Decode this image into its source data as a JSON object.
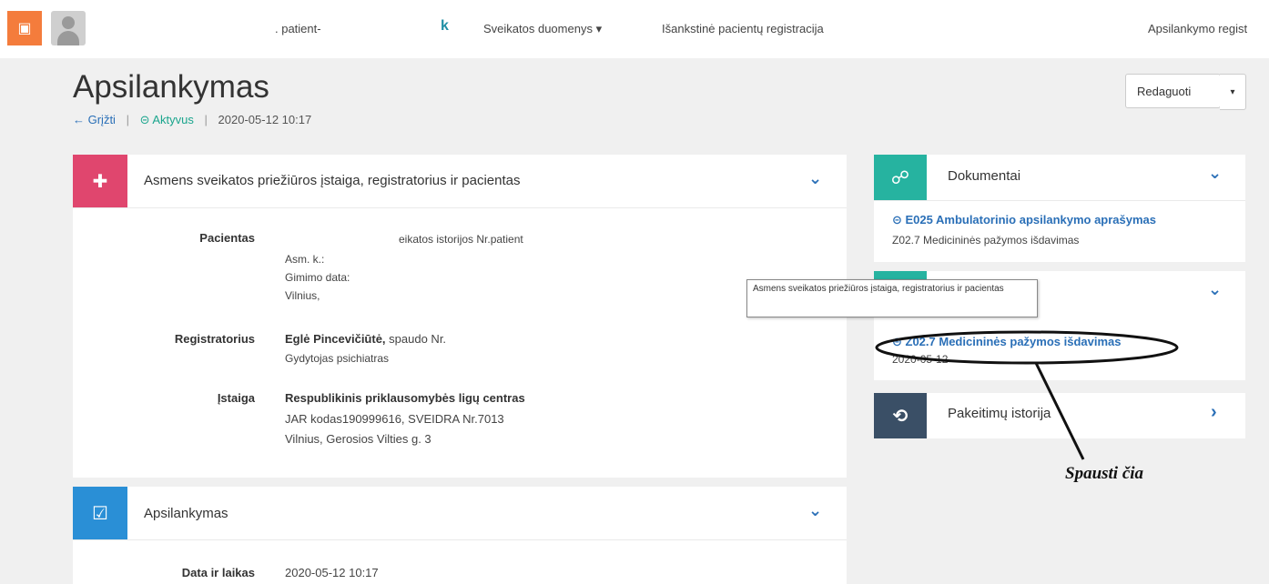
{
  "nav": {
    "patient_text": ". patient-",
    "logo_letter": "k",
    "menu_health": "Sveikatos duomenys ▾",
    "menu_prereg": "Išankstinė pacientų registracija",
    "menu_visit_reg": "Apsilankymo regist"
  },
  "header": {
    "title": "Apsilankymas",
    "back_label": "← Grįžti",
    "status_label": "⊝ Aktyvus",
    "datetime": "2020-05-12 10:17",
    "edit_label": "Redaguoti",
    "edit_caret": "▾"
  },
  "institution_panel": {
    "title": "Asmens sveikatos priežiūros įstaiga, registratorius ir pacientas",
    "patient": {
      "label": "Pacientas",
      "line1": "eikatos istorijos Nr.patient",
      "line2": "Asm. k.:",
      "line3": "Gimimo data:",
      "line4": "Vilnius,"
    },
    "registrar": {
      "label": "Registratorius",
      "name": "Eglė Pincevičiūtė,",
      "stamp": "spaudo Nr.",
      "role": "Gydytojas psichiatras"
    },
    "institution": {
      "label": "Įstaiga",
      "name": "Respublikinis priklausomybės ligų centras",
      "code": "JAR kodas190999616, SVEIDRA Nr.7013",
      "address": "Vilnius, Gerosios Vilties g. 3"
    }
  },
  "visit_panel": {
    "title": "Apsilankymas",
    "date_label": "Data ir laikas",
    "date_value": "2020-05-12 10:17"
  },
  "documents_panel": {
    "title": "Dokumentai",
    "link": "⊝ E025 Ambulatorinio apsilankymo aprašymas",
    "sub": "Z02.7 Medicininės pažymos išdavimas"
  },
  "certificate_panel": {
    "link": "⊝ Z02.7 Medicininės pažymos išdavimas",
    "sub": "2020-05-12"
  },
  "history_panel": {
    "title": "Pakeitimų istorija"
  },
  "tooltip": {
    "text": "Asmens sveikatos priežiūros įstaiga, registratorius ir pacientas"
  },
  "annotation": {
    "text": "Spausti čia"
  },
  "colors": {
    "brand": "#f47c3c",
    "institution_icon": "#e0466e",
    "visit_icon": "#2a8fd6",
    "documents_icon": "#26b3a0",
    "history_icon": "#3a4f66",
    "link": "#2a6fb7"
  },
  "icons": {
    "brand": "document-icon",
    "institution": "plus-icon",
    "visit": "checkbox-icon",
    "documents": "link-icon",
    "certificate": "document-icon",
    "history": "history-icon"
  }
}
